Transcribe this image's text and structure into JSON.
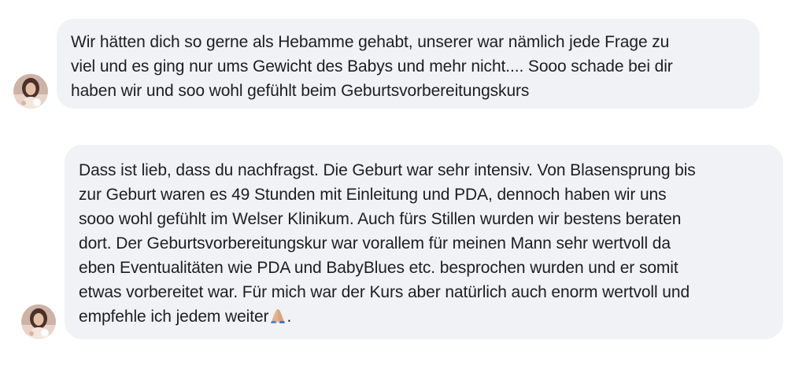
{
  "conversation": {
    "messages": [
      {
        "text": "Wir hätten dich so gerne als Hebamme gehabt, unserer war nämlich jede Frage zu\nviel und es ging nur ums Gewicht des Babys und mehr nicht.... Sooo schade bei dir\nhaben wir und soo wohl gefühlt beim Geburtsvorbereitungskurs"
      },
      {
        "text": "Dass ist lieb, dass du nachfragst. Die Geburt war sehr intensiv. Von Blasensprung bis\nzur Geburt waren es 49 Stunden mit Einleitung und PDA, dennoch haben wir uns\nsooo wohl gefühlt im Welser Klinikum. Auch fürs Stillen wurden wir bestens beraten\ndort. Der Geburtsvorbereitungskur war vorallem für meinen Mann sehr wertvoll da\neben Eventualitäten wie PDA und BabyBlues etc. besprochen wurden und er somit\netwas vorbereitet war. Für mich war der Kurs aber natürlich auch enorm wertvoll und\nempfehle ich jedem weiter",
        "trailing_text": ".",
        "emoji": "folded-hands"
      }
    ]
  },
  "colors": {
    "bubble_bg": "#f0f2f5",
    "text": "#1c1e21"
  }
}
